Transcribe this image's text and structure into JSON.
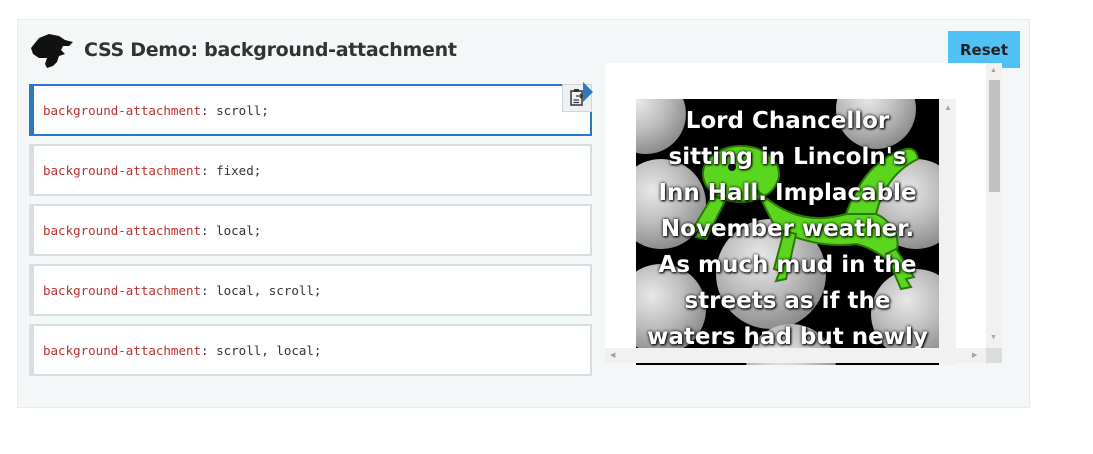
{
  "header": {
    "title": "CSS Demo: background-attachment",
    "reset_label": "Reset",
    "logo_icon": "dinosaur-logo-icon"
  },
  "choices": [
    {
      "property": "background-attachment",
      "value": " scroll;",
      "selected": true
    },
    {
      "property": "background-attachment",
      "value": " fixed;",
      "selected": false
    },
    {
      "property": "background-attachment",
      "value": " local;",
      "selected": false
    },
    {
      "property": "background-attachment",
      "value": " local, scroll;",
      "selected": false
    },
    {
      "property": "background-attachment",
      "value": " scroll, local;",
      "selected": false
    }
  ],
  "output": {
    "text_lines": [
      "Lord Chancellor",
      "sitting in Lincoln's",
      "Inn Hall. Implacable",
      "November weather.",
      "As much mud in the",
      "streets as if the",
      "waters had but newly"
    ],
    "copy_icon": "clipboard-icon",
    "selected_indicator_icon": "triangle-right-icon"
  },
  "colors": {
    "accent": "#2b79c2",
    "reset_bg": "#4fc1f5",
    "property_color": "#b8322f"
  }
}
